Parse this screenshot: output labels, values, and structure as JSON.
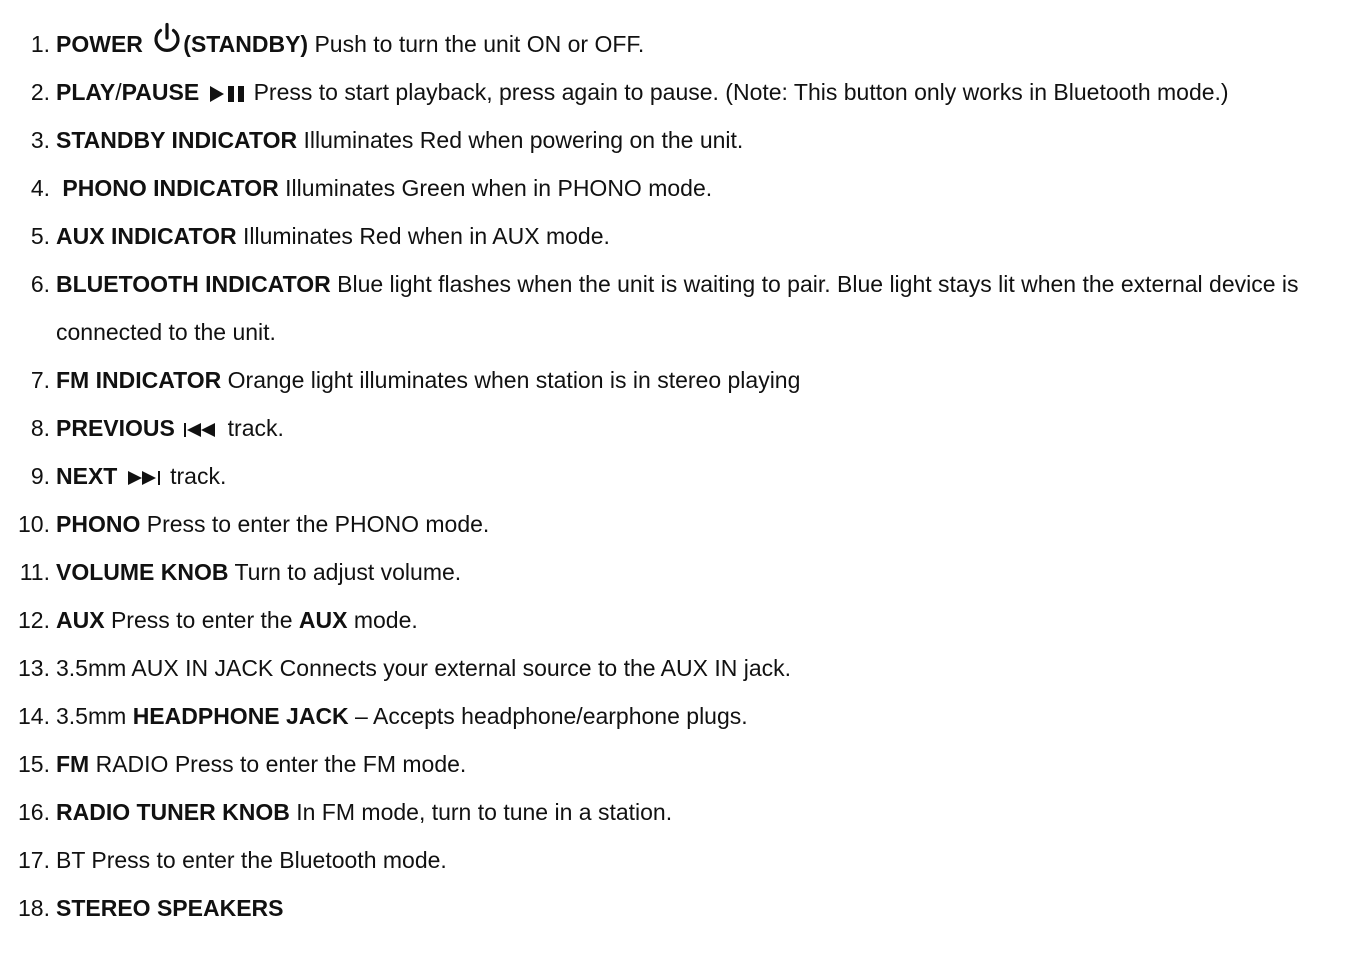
{
  "icons": {
    "power": "power-standby-icon",
    "play_pause": "play-pause-icon",
    "previous": "previous-track-icon",
    "next": "next-track-icon"
  },
  "items": [
    {
      "num": "1.",
      "a": "POWER",
      "b": "(STANDBY)",
      "c": " Push to turn the unit ON or OFF."
    },
    {
      "num": "2.",
      "a": "PLAY",
      "slash": "/",
      "b": "PAUSE",
      "c": "Press to start playback, press again to pause. (Note: This button only works in Bluetooth mode.)"
    },
    {
      "num": "3.",
      "a": "STANDBY INDICATOR",
      "c": " Illuminates Red when powering on the unit."
    },
    {
      "num": "4.",
      "a": "PHONO INDICATOR",
      "c": " Illuminates Green when in PHONO mode."
    },
    {
      "num": "5.",
      "a": "AUX INDICATOR",
      "c": " Illuminates Red when in AUX mode."
    },
    {
      "num": "6.",
      "a": "BLUETOOTH INDICATOR",
      "c": " Blue light flashes when the unit is waiting to pair. Blue light stays lit when the external device is connected to the unit."
    },
    {
      "num": "7.",
      "a": "FM INDICATOR",
      "c": " Orange light illuminates when station is in stereo playing"
    },
    {
      "num": "8.",
      "a": "PREVIOUS",
      "c": " track."
    },
    {
      "num": "9.",
      "a": "NEXT",
      "c": " track."
    },
    {
      "num": "10.",
      "a": "PHONO",
      "c": " Press to enter the PHONO mode."
    },
    {
      "num": "11.",
      "a": "VOLUME KNOB",
      "c": " Turn to adjust volume."
    },
    {
      "num": "12.",
      "a": "AUX",
      "c": " Press to enter the ",
      "d": "AUX",
      "e": " mode."
    },
    {
      "num": "13.",
      "c": "3.5mm AUX IN JACK Connects your external source to the AUX IN jack."
    },
    {
      "num": "14.",
      "pre": "3.5mm ",
      "a": "HEADPHONE JACK",
      "c": " – Accepts headphone/earphone plugs."
    },
    {
      "num": "15.",
      "a": "FM",
      "c": " RADIO Press to enter the FM mode."
    },
    {
      "num": "16.",
      "a": "RADIO TUNER KNOB",
      "c": " In FM mode, turn to tune in a station."
    },
    {
      "num": "17.",
      "c": "BT Press to enter the Bluetooth mode."
    },
    {
      "num": "18.",
      "a": "STEREO SPEAKERS"
    }
  ]
}
